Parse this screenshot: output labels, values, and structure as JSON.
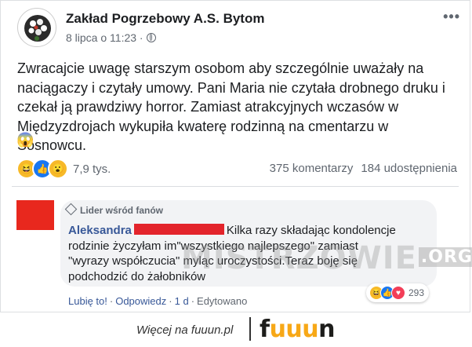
{
  "post": {
    "page_name": "Zakład Pogrzebowy A.S. Bytom",
    "date": "8 lipca o 11:23 ·",
    "more": "•••",
    "text": "Zwracajcie uwagę starszym osobom aby szczególnie uważały na naciągaczy i czytały umowy. Pani Maria nie czytała drobnego druku i czekał ją prawdziwy horror. Zamiast atrakcyjnych wczasów w Międzyzdrojach wykupiła kwaterę rodzinną na cmentarzu w Sosnowcu.",
    "emoji": "😱",
    "reaction_icons": [
      "haha-icon",
      "like-icon",
      "wow-icon"
    ],
    "reaction_count": "7,9 tys.",
    "comments_count": "375 komentarzy",
    "shares_count": "184 udostępnienia"
  },
  "comment": {
    "badge": "Lider wśród fanów",
    "author": "Aleksandra",
    "text": "Kilka razy składając kondolencje rodzinie życzyłam im\"wszystkiego najlepszego\" zamiast \"wyrazy współczucia\" myląc uroczystości.Teraz boję się podchodzić do żałobników",
    "like": "Lubię to!",
    "reply": "Odpowiedz",
    "time": "1 d",
    "edited": "Edytowano",
    "reaction_icons": [
      "haha-icon",
      "like-icon",
      "love-icon"
    ],
    "reaction_count": "293"
  },
  "watermark": {
    "main": "MISTRZOWIE",
    "suffix": ".ORG"
  },
  "footer": {
    "text": "Więcej na fuuun.pl",
    "logo": "fuuun"
  },
  "colors": {
    "link": "#385898",
    "redaction": "#e3242b",
    "logo_accent": "#f7a817"
  }
}
